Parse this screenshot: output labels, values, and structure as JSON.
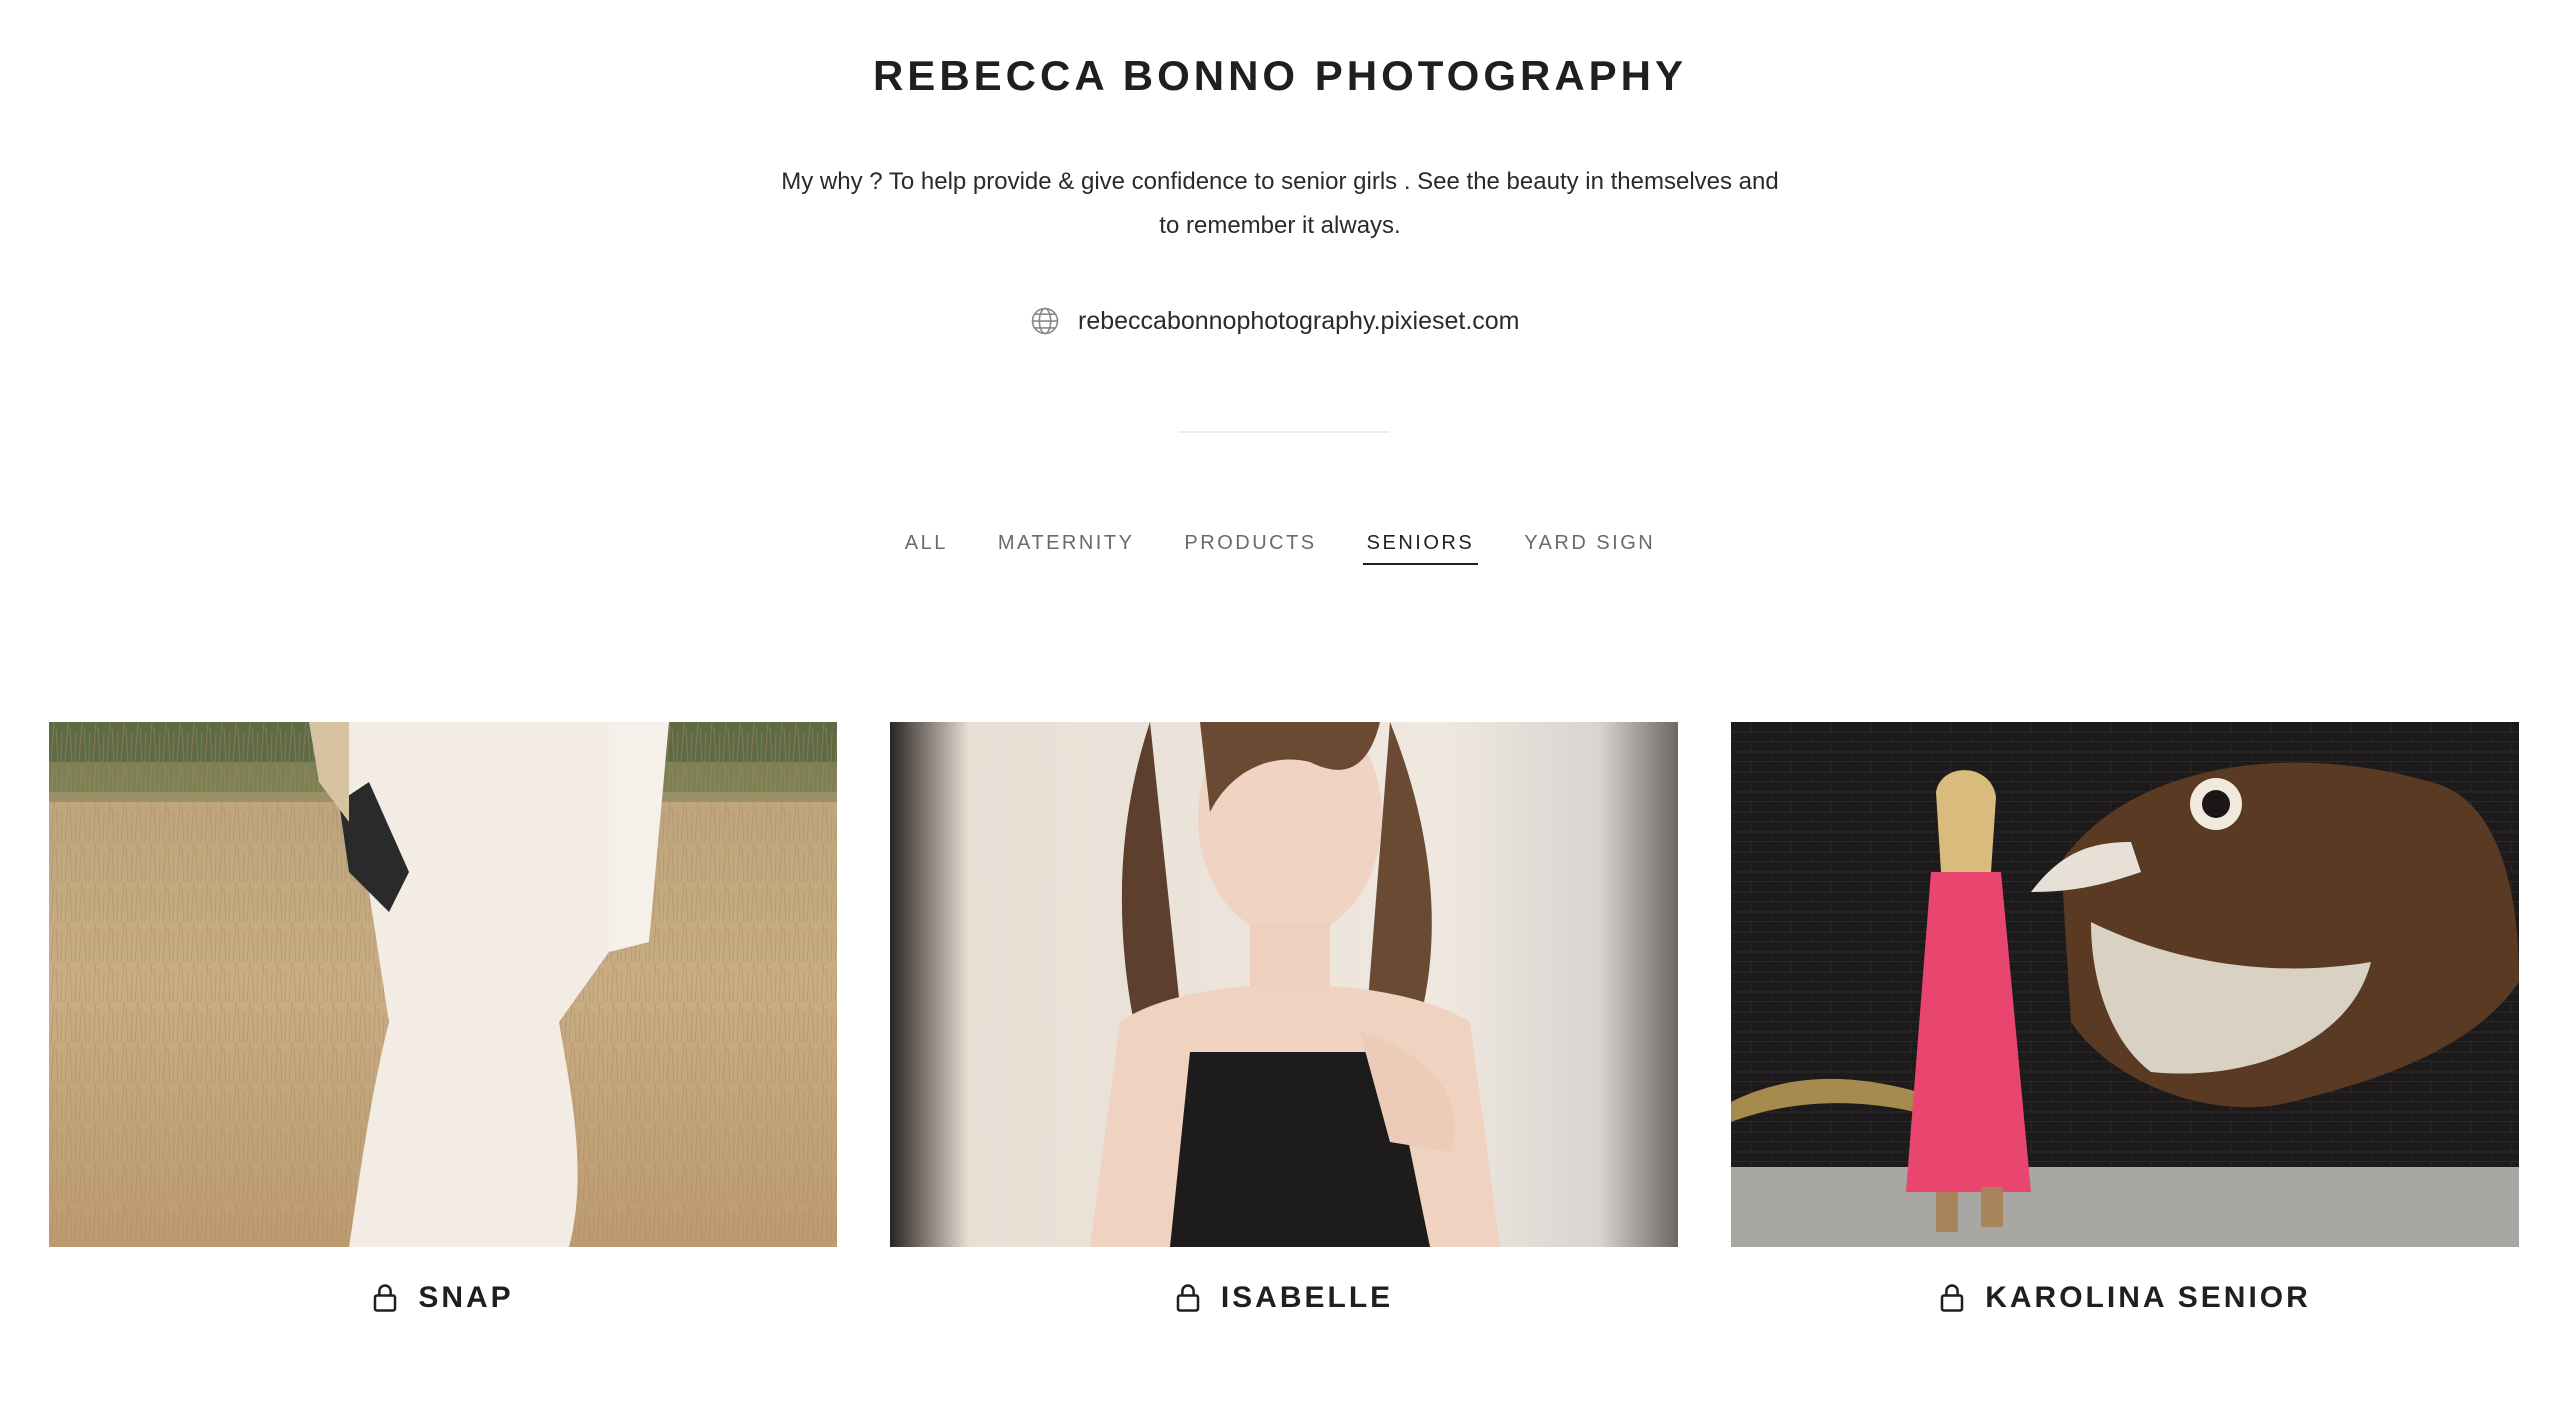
{
  "header": {
    "title": "REBECCA BONNO PHOTOGRAPHY",
    "description": "My why ? To help provide & give confidence to senior girls . See the beauty in themselves and to remember it always.",
    "website": "rebeccabonnophotography.pixieset.com",
    "website_icon": "globe-icon"
  },
  "nav": {
    "items": [
      {
        "label": "ALL",
        "active": false
      },
      {
        "label": "MATERNITY",
        "active": false
      },
      {
        "label": "PRODUCTS",
        "active": false
      },
      {
        "label": "SENIORS",
        "active": true
      },
      {
        "label": "YARD SIGN",
        "active": false
      }
    ]
  },
  "galleries": [
    {
      "title": "SNAP",
      "locked": true,
      "icon": "lock-icon"
    },
    {
      "title": "ISABELLE",
      "locked": true,
      "icon": "lock-icon"
    },
    {
      "title": "KAROLINA SENIOR",
      "locked": true,
      "icon": "lock-icon"
    }
  ],
  "colors": {
    "text": "#1f1f1f",
    "nav_inactive": "#6a6a6a",
    "background": "#ffffff"
  }
}
